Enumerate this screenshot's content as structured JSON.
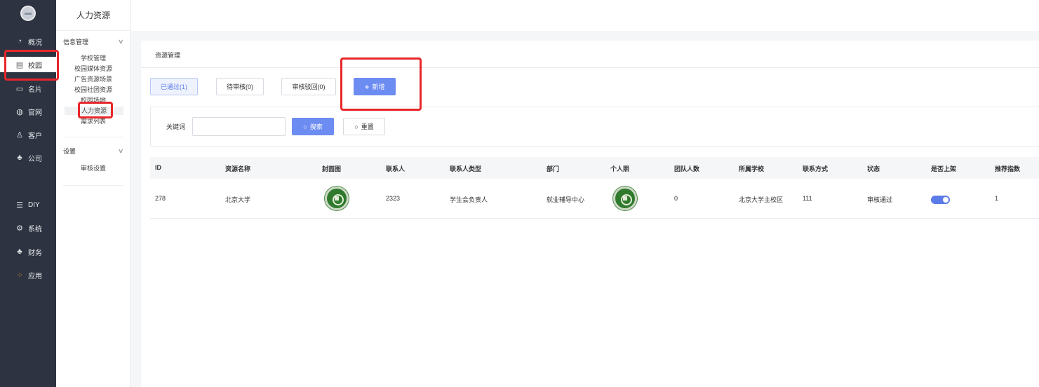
{
  "nav": {
    "items": [
      {
        "label": "概况",
        "icon": "pie-chart-icon"
      },
      {
        "label": "校园",
        "icon": "building-icon"
      },
      {
        "label": "名片",
        "icon": "card-icon"
      },
      {
        "label": "官网",
        "icon": "globe-icon"
      },
      {
        "label": "客户",
        "icon": "user-icon"
      },
      {
        "label": "公司",
        "icon": "org-icon"
      },
      {
        "label": "DIY",
        "icon": "diy-icon"
      },
      {
        "label": "系统",
        "icon": "gear-icon"
      },
      {
        "label": "财务",
        "icon": "finance-icon"
      },
      {
        "label": "应用",
        "icon": "apps-icon"
      }
    ]
  },
  "subnav": {
    "title": "人力资源",
    "groups": [
      {
        "label": "信息管理",
        "items": [
          "学校管理",
          "校园媒体资源",
          "广告资源场景",
          "校园社团资源",
          "校园场地",
          "人力资源",
          "需求列表"
        ]
      },
      {
        "label": "设置",
        "items": [
          "审核设置"
        ]
      }
    ]
  },
  "main": {
    "breadcrumb": "资源管理",
    "tabs": [
      "已通过(1)",
      "待审核(0)",
      "审核驳回(0)"
    ],
    "add_label": "新增",
    "search": {
      "keyword_label": "关键词",
      "keyword_value": "",
      "search_label": "搜索",
      "reset_label": "重置"
    },
    "table": {
      "columns": [
        "ID",
        "资源名称",
        "封面图",
        "联系人",
        "联系人类型",
        "部门",
        "个人照",
        "团队人数",
        "所属学校",
        "联系方式",
        "状态",
        "是否上架",
        "推荐指数"
      ],
      "rows": [
        {
          "id": "278",
          "name": "北京大学",
          "contact": "2323",
          "contact_type": "学生会负责人",
          "dept": "就业辅导中心",
          "team_size": "0",
          "school": "北京大学主校区",
          "phone": "111",
          "status": "审核通过",
          "on_shelf": true,
          "recommend": "1"
        }
      ]
    }
  },
  "colors": {
    "nav_bg": "#2d3340",
    "primary": "#6d8cf2",
    "annotation": "#e8262a"
  }
}
